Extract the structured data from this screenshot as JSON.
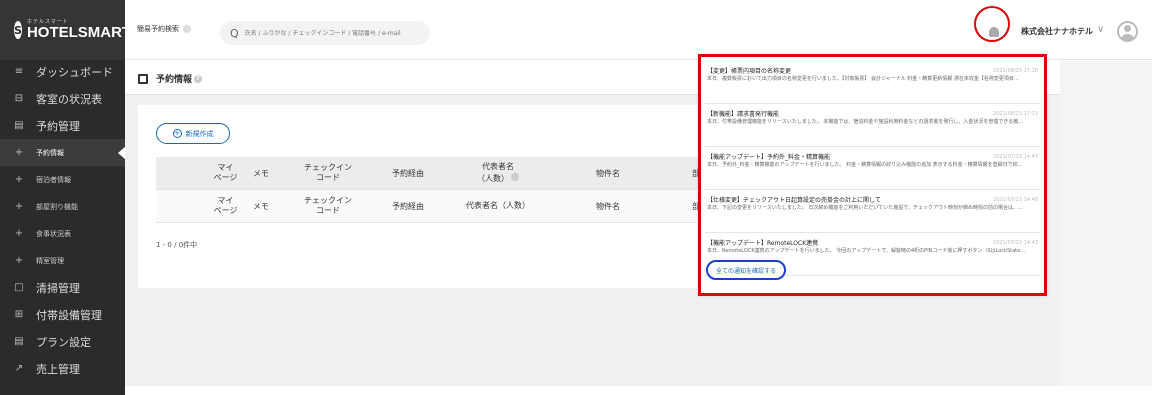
{
  "brand": {
    "sub": "ホテルスマート",
    "name": "HOTELSMART",
    "mark": "S"
  },
  "sidebar": {
    "items": [
      {
        "label": "ダッシュボード",
        "icon": "≡"
      },
      {
        "label": "客室の状況表",
        "icon": "⊟"
      },
      {
        "label": "予約管理",
        "icon": "▤"
      },
      {
        "label": "予約情報",
        "icon": "+"
      },
      {
        "label": "宿泊者情報",
        "icon": "+"
      },
      {
        "label": "部屋割り機能",
        "icon": "+"
      },
      {
        "label": "食事状況表",
        "icon": "+"
      },
      {
        "label": "精室管理",
        "icon": "+"
      },
      {
        "label": "清掃管理",
        "icon": "□"
      },
      {
        "label": "付帯設備管理",
        "icon": "⊞"
      },
      {
        "label": "プラン設定",
        "icon": "▤"
      },
      {
        "label": "売上管理",
        "icon": "↗"
      }
    ]
  },
  "header": {
    "quick_label": "簡易予約検索",
    "search_icon": "Q",
    "search_placeholder": "氏名 / ふりがな / チェックインコード / 電話番号 / e-mail",
    "company": "株式会社ナナホテル",
    "chevron": "∨"
  },
  "page": {
    "title": "予約情報",
    "help": "?"
  },
  "new_button": {
    "label": "新規作成",
    "plus": "+"
  },
  "table": {
    "columns": [
      {
        "top": "マイ",
        "bottom": "ページ"
      },
      {
        "top": "メモ",
        "bottom": ""
      },
      {
        "top": "チェックイン",
        "bottom": "コード"
      },
      {
        "top": "予約経由",
        "bottom": ""
      },
      {
        "top": "代表者名",
        "bottom": "（人数）"
      },
      {
        "top": "物件名",
        "bottom": ""
      },
      {
        "top": "部屋番号",
        "bottom": ""
      }
    ],
    "footer_row": {
      "c1a": "マイ",
      "c1b": "ページ",
      "c2": "メモ",
      "c3a": "チェックイン",
      "c3b": "コード",
      "c4": "予約経由",
      "c5": "代表者名（人数）",
      "c6": "物件名",
      "c7": "部屋番号"
    },
    "count": "1 - 0 / 0件中"
  },
  "notifications": {
    "items": [
      {
        "title": "【変更】帳票内項目の名称変更",
        "date": "2021/08/23 17:16",
        "body": "本日、複数帳票において出力項目の名称変更を行いました。【対象帳票】 会計ジャーナル 料金・精算更新情報 滞在未収金【名称変更項目…"
      },
      {
        "title": "【新機能】請求書発行機能",
        "date": "2021/08/23 17:13",
        "body": "本日、付帯設備管理機能をリリースいたしました。 本機能では、宿泊料金や施設利用料金などの請求書を発行し、入金状況を管理できる機…"
      },
      {
        "title": "【機能アップデート】予約外_料金・精算機能",
        "date": "2021/07/23 14:47",
        "body": "本日、予約外_料金・精算機能のアップデートを行いました。 料金・精算情報の絞り込み機能の追加 表示する料金・精算情報を登録日で絞…"
      },
      {
        "title": "【仕様変更】チェックアウト日起算設定の売掛金の計上に関して",
        "date": "2021/07/23 14:48",
        "body": "本日、下記の変更をリリースいたしました。 日次締め機能をご利用いただいていた施設で、チェックアウト時刻が締め時刻の前の場合は、…"
      },
      {
        "title": "【機能アップデート】RemoteLOCK連携",
        "date": "2021/07/23 14:43",
        "body": "本日、RemoteLOCK連携のアップデートを行いました。 今回のアップデートで、解錠時の4桁のPINコード後に押すボタン（SはLockState…"
      }
    ],
    "all_label": "全ての通知を確認する"
  },
  "colors": {
    "sidebar": "#2b2b2b",
    "accent": "#1a67b8",
    "annotation_red": "#e00000",
    "annotation_blue": "#1b3fd0"
  }
}
